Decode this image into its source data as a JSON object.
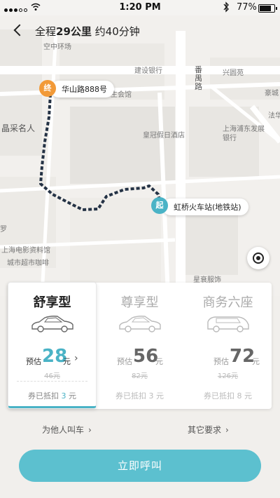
{
  "status": {
    "time": "1:20 PM",
    "battery": "77%"
  },
  "route": {
    "prefix": "全程",
    "distance": "29公里",
    "duration": "约40分钟"
  },
  "map": {
    "labels": {
      "l1": "空中环场",
      "l2": "建设银行",
      "l3": "番禺路",
      "l4": "兴圆苑",
      "l5": "豪城",
      "l6": "法华",
      "l7": "生会馆",
      "l8": "晶采名人",
      "l9": "皇冠假日酒店",
      "l10": "上海浦东发展银行",
      "l11": "上海电影资料馆",
      "l12": "城市超市咖啡",
      "l13": "星衰服饰",
      "l14": "罗"
    },
    "end_marker": {
      "glyph": "终",
      "label": "华山路888号"
    },
    "start_marker": {
      "glyph": "起",
      "label": "虹桥火车站(地铁站)"
    }
  },
  "cars": [
    {
      "name": "舒享型",
      "pre": "预估",
      "price": "28",
      "unit": "元",
      "original": "46元",
      "coupon_pre": "券已抵扣",
      "coupon_amt": "3",
      "coupon_unit": "元"
    },
    {
      "name": "尊享型",
      "pre": "预估",
      "price": "56",
      "unit": "元",
      "original": "82元",
      "coupon_pre": "券已抵扣",
      "coupon_amt": "3",
      "coupon_unit": "元"
    },
    {
      "name": "商务六座",
      "pre": "预估",
      "price": "72",
      "unit": "元",
      "original": "126元",
      "coupon_pre": "券已抵扣",
      "coupon_amt": "8",
      "coupon_unit": "元"
    }
  ],
  "options": {
    "call_for_others": "为他人叫车",
    "other_requests": "其它要求"
  },
  "call_button": "立即呼叫",
  "colors": {
    "accent": "#4ab3c6",
    "end_marker": "#f29a38",
    "route_line": "#243245"
  }
}
